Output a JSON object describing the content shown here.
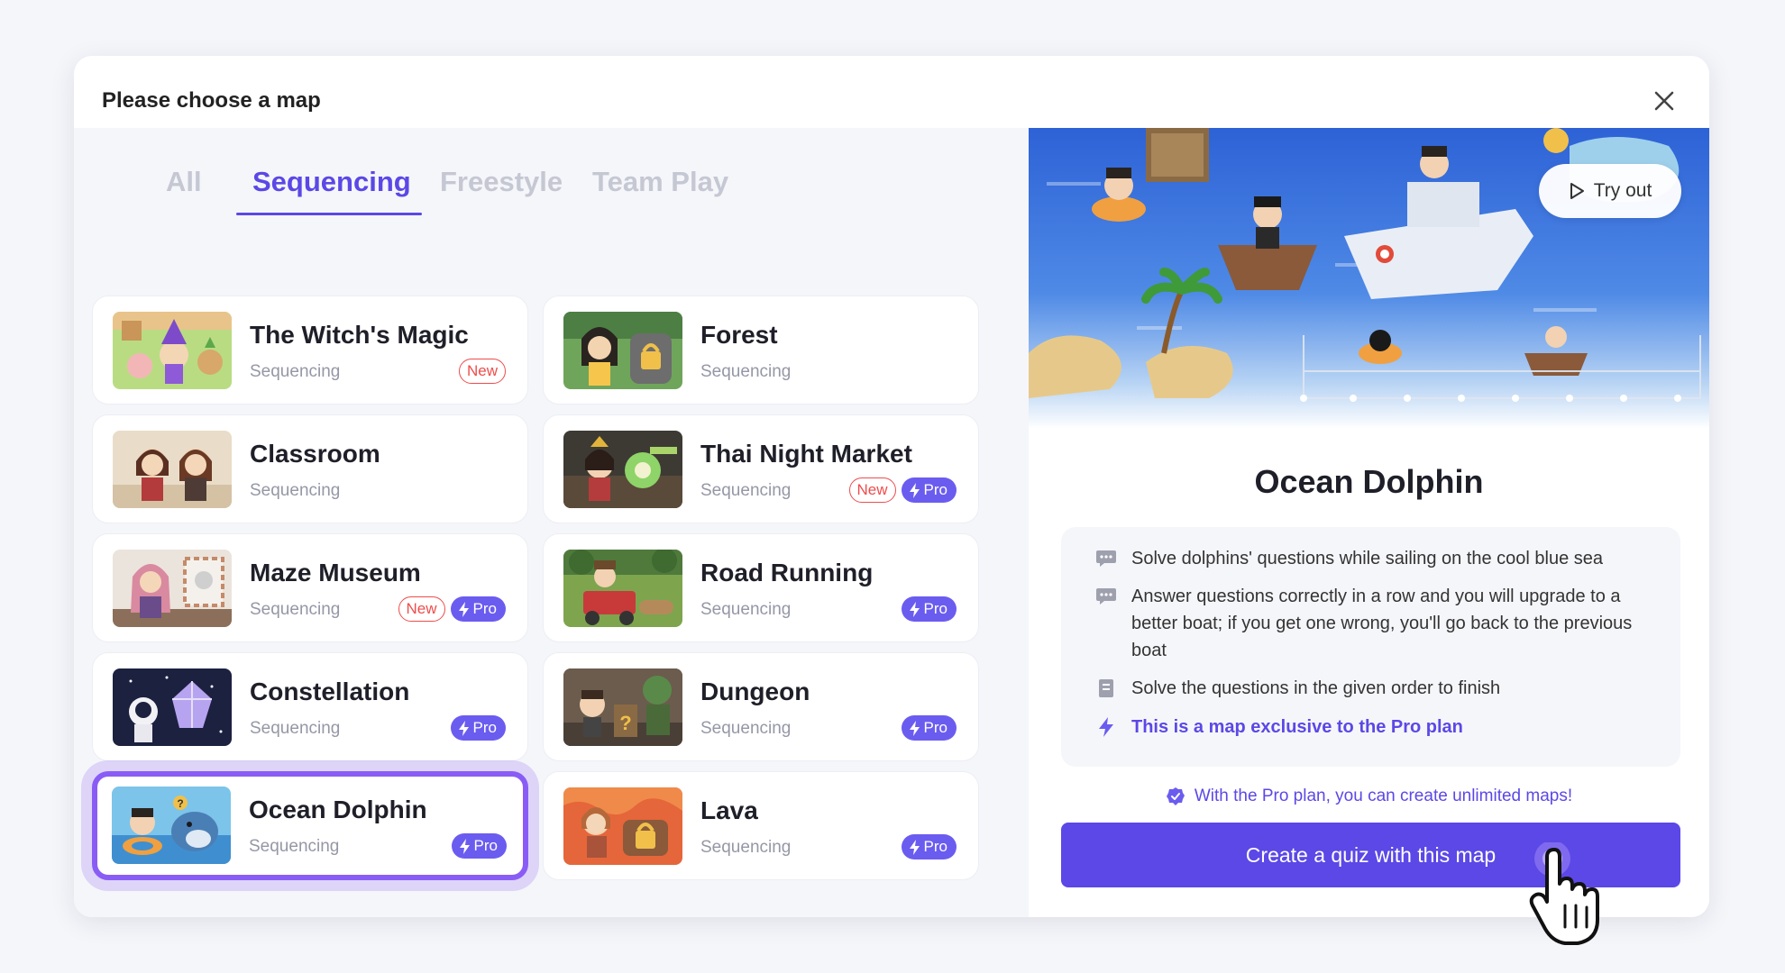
{
  "modal": {
    "title": "Please choose a map",
    "close_icon": "close-icon"
  },
  "tabs": [
    {
      "label": "All",
      "active": false
    },
    {
      "label": "Sequencing",
      "active": true
    },
    {
      "label": "Freestyle",
      "active": false
    },
    {
      "label": "Team Play",
      "active": false
    }
  ],
  "maps": [
    {
      "name": "The Witch's Magic",
      "category": "Sequencing",
      "new": true,
      "pro": false
    },
    {
      "name": "Forest",
      "category": "Sequencing",
      "new": false,
      "pro": false
    },
    {
      "name": "Classroom",
      "category": "Sequencing",
      "new": false,
      "pro": false
    },
    {
      "name": "Thai Night Market",
      "category": "Sequencing",
      "new": true,
      "pro": true
    },
    {
      "name": "Maze Museum",
      "category": "Sequencing",
      "new": true,
      "pro": true
    },
    {
      "name": "Road Running",
      "category": "Sequencing",
      "new": false,
      "pro": true
    },
    {
      "name": "Constellation",
      "category": "Sequencing",
      "new": false,
      "pro": true
    },
    {
      "name": "Dungeon",
      "category": "Sequencing",
      "new": false,
      "pro": true
    },
    {
      "name": "Ocean Dolphin",
      "category": "Sequencing",
      "new": false,
      "pro": true,
      "selected": true
    },
    {
      "name": "Lava",
      "category": "Sequencing",
      "new": false,
      "pro": true
    }
  ],
  "badges": {
    "new_label": "New",
    "pro_label": "Pro"
  },
  "detail": {
    "try_out_label": "Try out",
    "title": "Ocean Dolphin",
    "items": [
      {
        "icon": "chat-bubble-icon",
        "text": "Solve dolphins' questions while sailing on the cool blue sea"
      },
      {
        "icon": "chat-bubble-icon",
        "text": "Answer questions correctly in a row and you will upgrade to a better boat; if you get one wrong, you'll go back to the previous boat"
      },
      {
        "icon": "book-icon",
        "text": "Solve the questions in the given order to finish"
      },
      {
        "icon": "lightning-icon",
        "text": "This is a map exclusive to the Pro plan"
      }
    ],
    "pro_note": "With the Pro plan, you can create unlimited maps!",
    "cta_label": "Create a quiz with this map"
  },
  "colors": {
    "accent": "#5b48e6",
    "pro_badge": "#6b5cf0",
    "new_badge": "#ef4c4c",
    "selected_border": "#8a5cf6",
    "background": "#f5f6fa"
  }
}
